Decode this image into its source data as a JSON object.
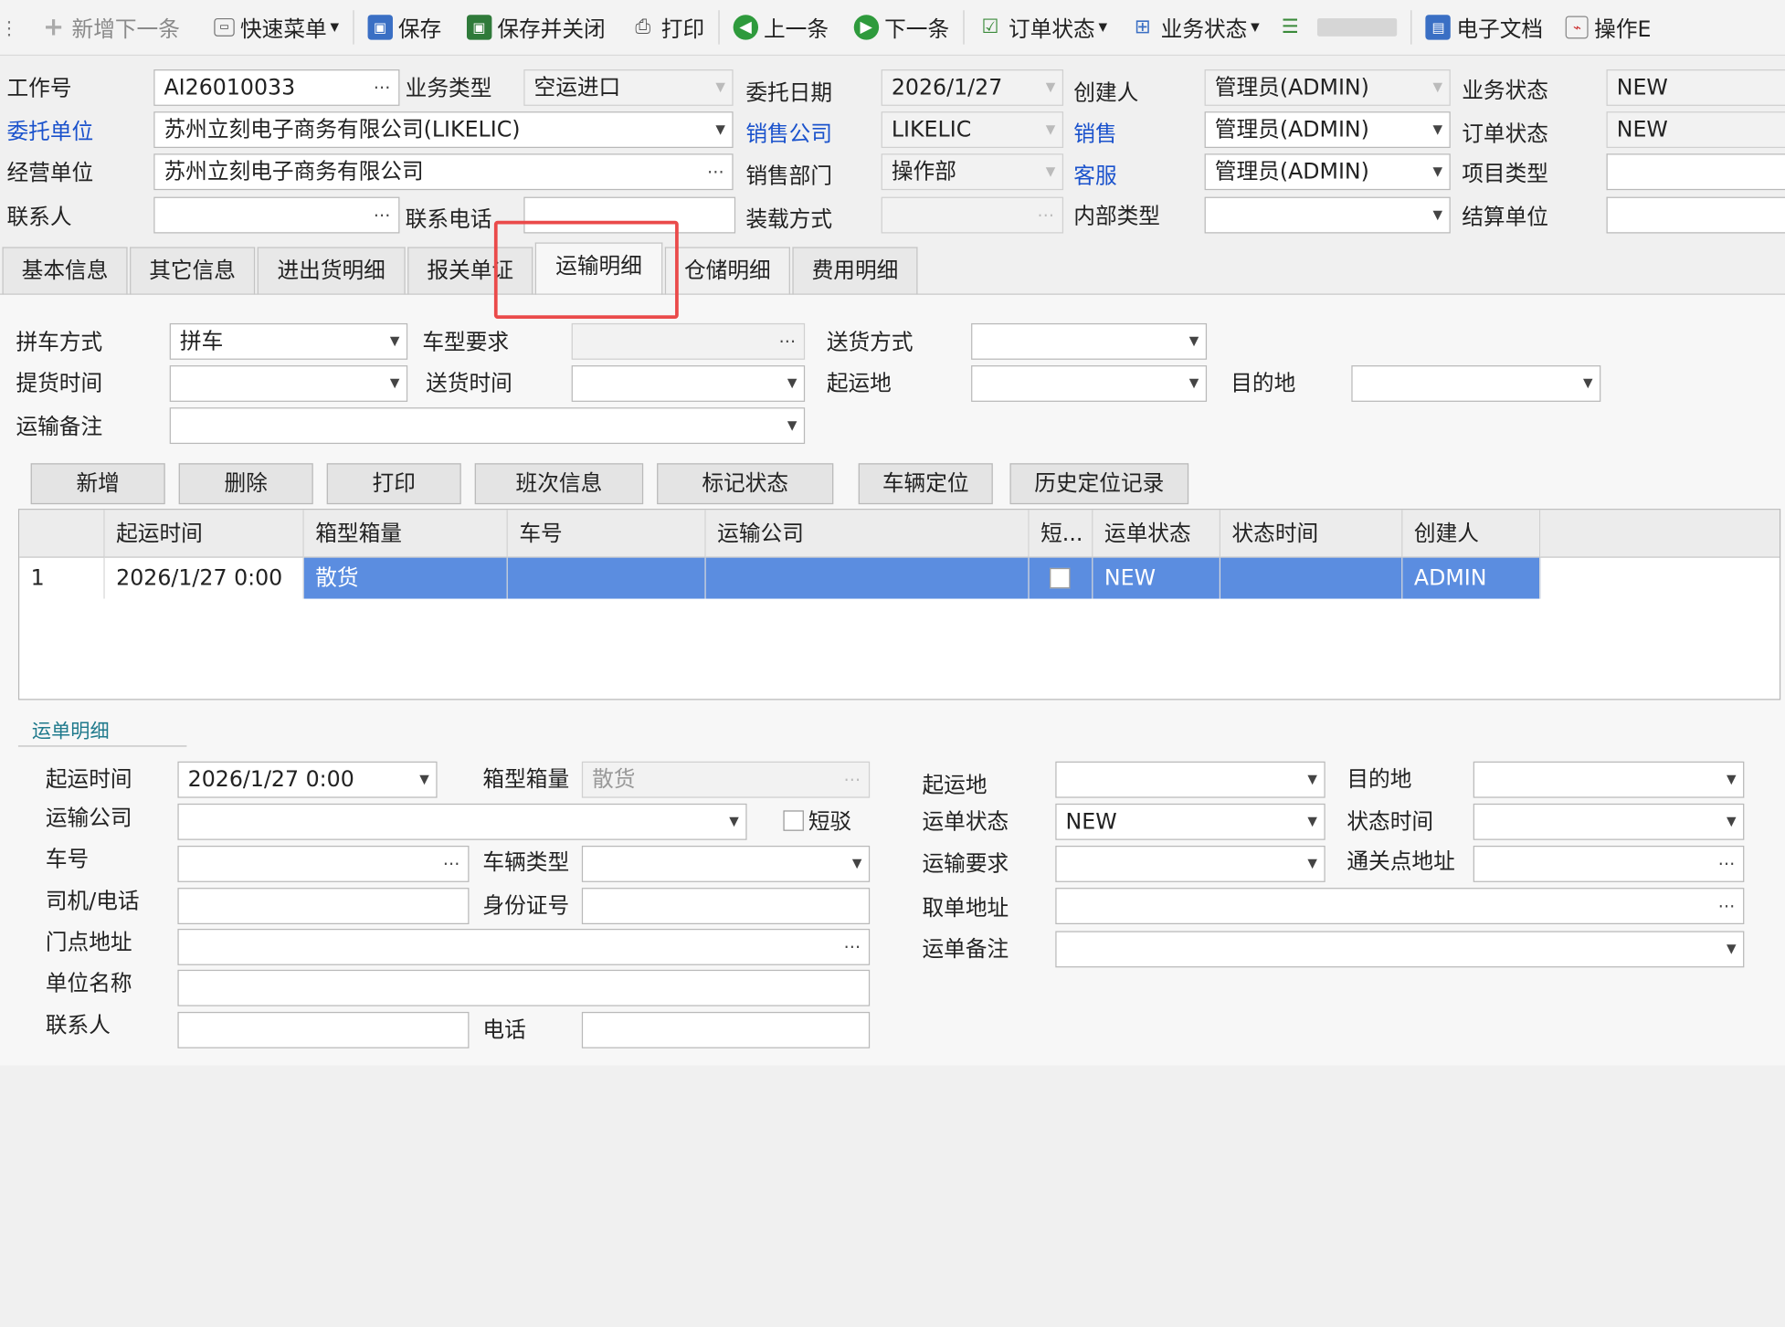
{
  "toolbar": {
    "new_next": "新增下一条",
    "quick_menu": "快速菜单",
    "save": "保存",
    "save_close": "保存并关闭",
    "print": "打印",
    "prev": "上一条",
    "next": "下一条",
    "order_status": "订单状态",
    "business_status": "业务状态",
    "e_docs": "电子文档",
    "operation": "操作E"
  },
  "header": {
    "job_no_label": "工作号",
    "job_no": "AI26010033",
    "biz_type_label": "业务类型",
    "biz_type": "空运进口",
    "entrust_date_label": "委托日期",
    "entrust_date": "2026/1/27",
    "creator_label": "创建人",
    "creator": "管理员(ADMIN)",
    "biz_status_label": "业务状态",
    "biz_status": "NEW",
    "client_label": "委托单位",
    "client": "苏州立刻电子商务有限公司(LIKELIC)",
    "sales_company_label": "销售公司",
    "sales_company": "LIKELIC",
    "sales_label": "销售",
    "sales": "管理员(ADMIN)",
    "order_status_label": "订单状态",
    "order_status": "NEW",
    "operator_label": "经营单位",
    "operator": "苏州立刻电子商务有限公司",
    "sales_dept_label": "销售部门",
    "sales_dept": "操作部",
    "cs_label": "客服",
    "cs": "管理员(ADMIN)",
    "project_type_label": "项目类型",
    "project_type": "",
    "contact_label": "联系人",
    "contact": "",
    "phone_label": "联系电话",
    "phone": "",
    "loading_label": "装载方式",
    "loading": "",
    "internal_type_label": "内部类型",
    "internal_type": "",
    "settle_label": "结算单位",
    "settle": ""
  },
  "tabs": [
    "基本信息",
    "其它信息",
    "进出货明细",
    "报关单证",
    "运输明细",
    "仓储明细",
    "费用明细"
  ],
  "active_tab": "运输明细",
  "transport": {
    "consolidation_label": "拼车方式",
    "consolidation": "拼车",
    "vehicle_req_label": "车型要求",
    "vehicle_req": "",
    "delivery_mode_label": "送货方式",
    "delivery_mode": "",
    "pickup_time_label": "提货时间",
    "pickup_time": "",
    "delivery_time_label": "送货时间",
    "delivery_time": "",
    "origin_label": "起运地",
    "origin": "",
    "dest_label": "目的地",
    "dest": "",
    "remark_label": "运输备注",
    "remark": ""
  },
  "actions": [
    "新增",
    "删除",
    "打印",
    "班次信息",
    "标记状态",
    "车辆定位",
    "历史定位记录"
  ],
  "grid": {
    "columns": [
      "",
      "起运时间",
      "箱型箱量",
      "车号",
      "运输公司",
      "短...",
      "运单状态",
      "状态时间",
      "创建人"
    ],
    "rows": [
      [
        "1",
        "2026/1/27 0:00",
        "散货",
        "",
        "",
        "",
        "NEW",
        "",
        "ADMIN"
      ]
    ]
  },
  "waybill": {
    "section_title": "运单明细",
    "start_time_label": "起运时间",
    "start_time": "2026/1/27 0:00",
    "container_label": "箱型箱量",
    "container": "散货",
    "origin_label": "起运地",
    "origin": "",
    "dest_label": "目的地",
    "dest": "",
    "carrier_label": "运输公司",
    "carrier": "",
    "short_label": "短驳",
    "status_label": "运单状态",
    "status": "NEW",
    "status_time_label": "状态时间",
    "status_time": "",
    "plate_label": "车号",
    "plate": "",
    "vehicle_type_label": "车辆类型",
    "vehicle_type": "",
    "transport_req_label": "运输要求",
    "transport_req": "",
    "customs_addr_label": "通关点地址",
    "customs_addr": "",
    "driver_label": "司机/电话",
    "driver": "",
    "id_label": "身份证号",
    "id_no": "",
    "pickup_addr_label": "取单地址",
    "pickup_addr": "",
    "door_addr_label": "门点地址",
    "door_addr": "",
    "remark_label": "运单备注",
    "remark": "",
    "unit_label": "单位名称",
    "unit": "",
    "contact_label": "联系人",
    "contact": "",
    "phone_label": "电话",
    "phone": ""
  }
}
